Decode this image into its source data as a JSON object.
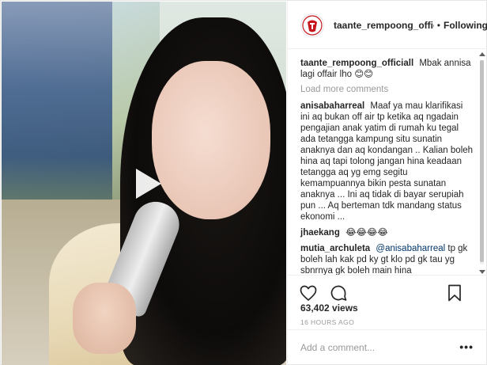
{
  "header": {
    "username": "taante_rempoong_officiall",
    "separator": "•",
    "follow_label": "Following"
  },
  "caption": {
    "username": "taante_rempoong_officiall",
    "text": "Mbak annisa lagi offair lho 😊😊"
  },
  "load_more_label": "Load more comments",
  "comments": [
    {
      "username": "anisabaharreal",
      "text": "Maaf ya mau klarifikasi ini aq bukan off air tp ketika aq ngadain pengajian anak yatim di rumah ku tegal ada tetangga kampung situ sunatin anaknya dan aq kondangan .. Kalian boleh hina aq tapi tolong jangan hina keadaan tetangga aq yg emg segitu kemampuannya bikin pesta sunatan anaknya ... Ini aq tidak di bayar serupiah pun ... Aq berteman tdk mandang status ekonomi ..."
    },
    {
      "username": "jhaekang",
      "text": "😂😂😂😂"
    },
    {
      "username": "mutia_archuleta",
      "mention": "@anisabaharreal",
      "text": "tp gk boleh lah kak pd ky gt klo pd gk tau yg sbnrnya gk boleh main hina seenaknya,,apalgi tujuan kak anisa mulia ttp semangat ya kak"
    }
  ],
  "views": "63,402 views",
  "timestamp": "16 HOURS AGO",
  "comment_box": {
    "placeholder": "Add a comment...",
    "more_label": "•••"
  },
  "icons": {
    "play": "play-icon",
    "like": "heart-icon",
    "comment": "comment-bubble-icon",
    "save": "bookmark-icon",
    "avatar": "profile-logo-icon"
  },
  "colors": {
    "border": "#efefef",
    "text": "#262626",
    "muted": "#999999",
    "mention": "#003569",
    "logo_red": "#c4161c"
  }
}
